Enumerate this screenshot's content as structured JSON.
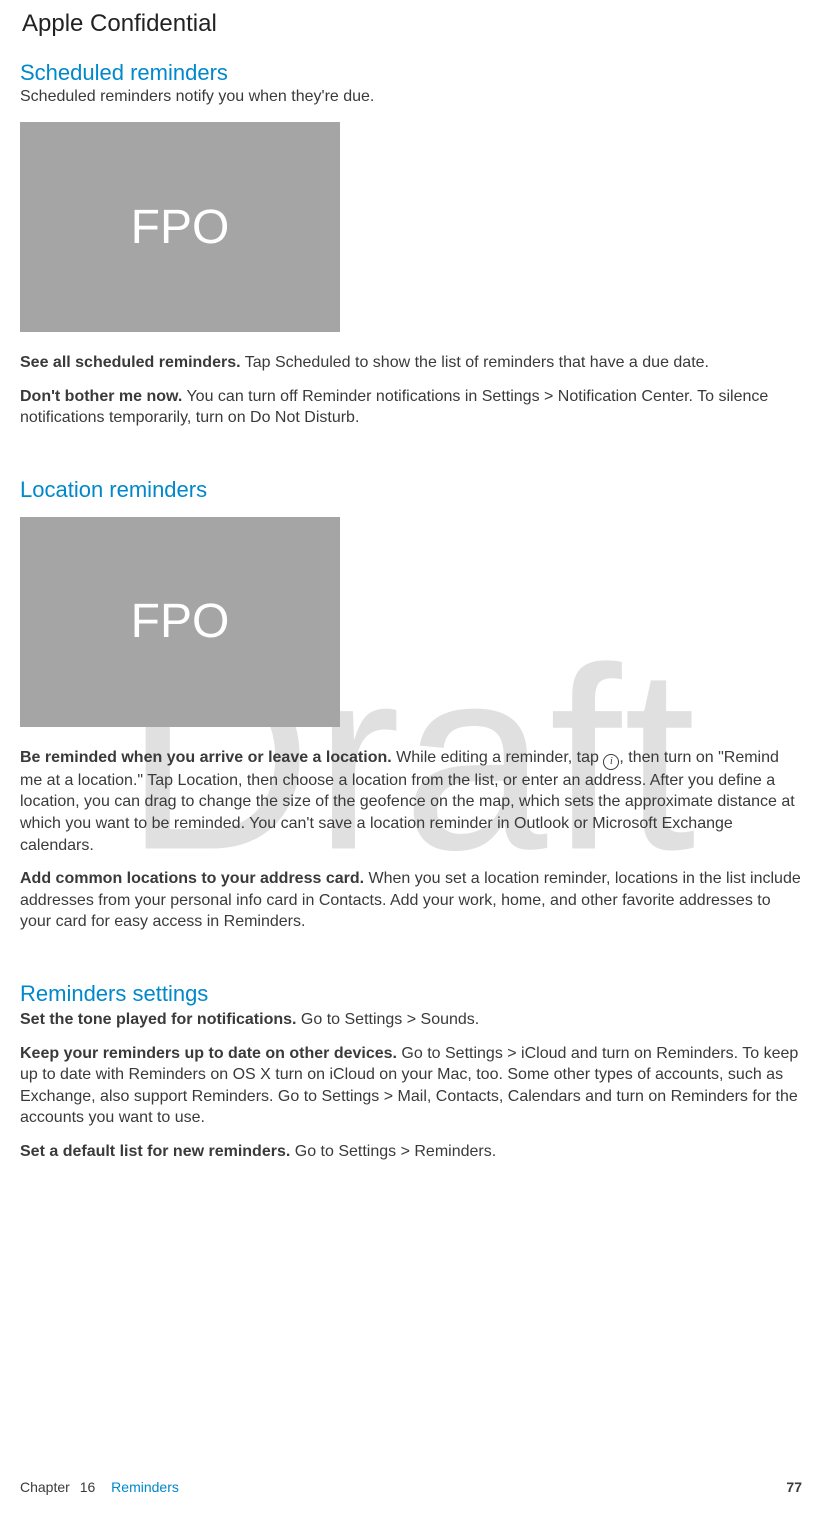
{
  "watermark": "Draft",
  "header": "Apple Confidential",
  "sections": {
    "scheduled": {
      "heading": "Scheduled reminders",
      "subtext": "Scheduled reminders notify you when they're due.",
      "fpo": "FPO",
      "p1_bold": "See all scheduled reminders.",
      "p1_text": " Tap Scheduled to show the list of reminders that have a due date.",
      "p2_bold": "Don't bother me now.",
      "p2_text": " You can turn off Reminder notifications in Settings > Notification Center. To silence notifications temporarily, turn on Do Not Disturb."
    },
    "location": {
      "heading": "Location reminders",
      "fpo": "FPO",
      "p1_bold": "Be reminded when you arrive or leave a location.",
      "p1_text_a": " While editing a reminder, tap ",
      "p1_text_b": ", then turn on \"Remind me at a location.\" Tap Location, then choose a location from the list, or enter an address. After you define a location, you can drag to change the size of the geofence on the map, which sets the approximate distance at which you want to be reminded. You can't save a location reminder in Outlook or Microsoft Exchange calendars.",
      "p2_bold": "Add common locations to your address card.",
      "p2_text": " When you set a location reminder, locations in the list include addresses from your personal info card in Contacts. Add your work, home, and other favorite addresses to your card for easy access in Reminders."
    },
    "settings": {
      "heading": "Reminders settings",
      "p1_bold": "Set the tone played for notifications.",
      "p1_text": " Go to Settings > Sounds.",
      "p2_bold": "Keep your reminders up to date on other devices.",
      "p2_text": " Go to Settings > iCloud and turn on Reminders. To keep up to date with Reminders on OS X turn on iCloud on your Mac, too. Some other types of accounts, such as Exchange, also support Reminders. Go to Settings > Mail, Contacts, Calendars and turn on Reminders for the accounts you want to use.",
      "p3_bold": "Set a default list for new reminders.",
      "p3_text": " Go to Settings > Reminders."
    }
  },
  "info_icon_glyph": "i",
  "footer": {
    "chapter_label": "Chapter",
    "chapter_num": "16",
    "chapter_name": "Reminders",
    "page": "77"
  }
}
